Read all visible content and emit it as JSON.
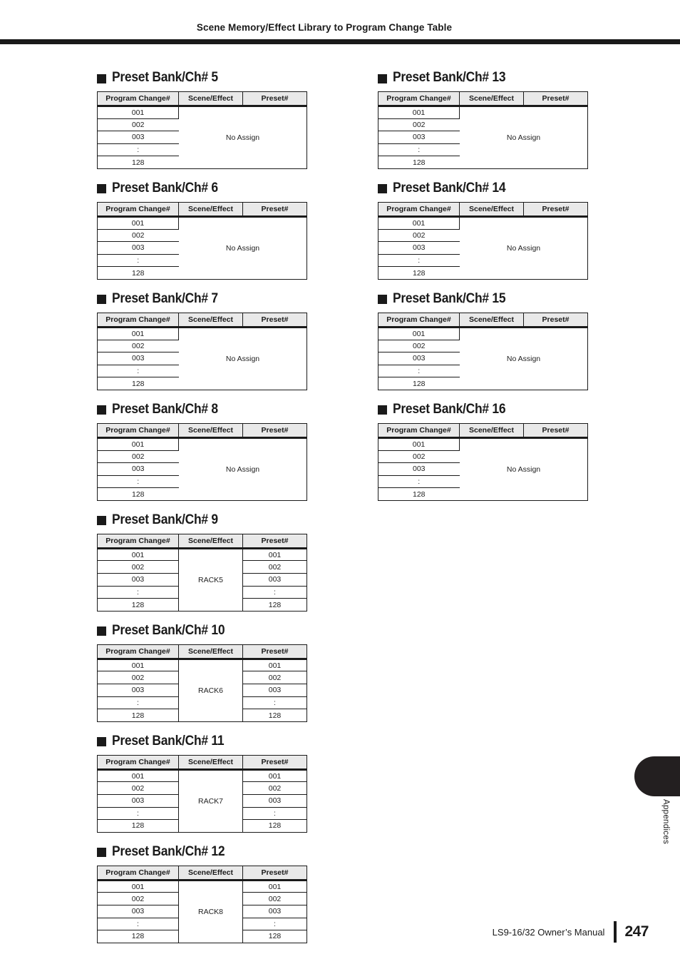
{
  "header": {
    "title": "Scene Memory/Effect Library to Program Change Table"
  },
  "table_headers": {
    "program_change": "Program Change#",
    "scene_effect": "Scene/Effect",
    "preset": "Preset#"
  },
  "program_change_rows": [
    "001",
    "002",
    "003",
    ":",
    "128"
  ],
  "no_assign_label": "No Assign",
  "sections": {
    "left": [
      {
        "title": "Preset Bank/Ch# 5",
        "assigned": false,
        "scene_effect": "No Assign",
        "program_change": [
          "001",
          "002",
          "003",
          ":",
          "128"
        ],
        "preset": []
      },
      {
        "title": "Preset Bank/Ch# 6",
        "assigned": false,
        "scene_effect": "No Assign",
        "program_change": [
          "001",
          "002",
          "003",
          ":",
          "128"
        ],
        "preset": []
      },
      {
        "title": "Preset Bank/Ch# 7",
        "assigned": false,
        "scene_effect": "No Assign",
        "program_change": [
          "001",
          "002",
          "003",
          ":",
          "128"
        ],
        "preset": []
      },
      {
        "title": "Preset Bank/Ch# 8",
        "assigned": false,
        "scene_effect": "No Assign",
        "program_change": [
          "001",
          "002",
          "003",
          ":",
          "128"
        ],
        "preset": []
      },
      {
        "title": "Preset Bank/Ch# 9",
        "assigned": true,
        "scene_effect": "RACK5",
        "program_change": [
          "001",
          "002",
          "003",
          ":",
          "128"
        ],
        "preset": [
          "001",
          "002",
          "003",
          ":",
          "128"
        ]
      },
      {
        "title": "Preset Bank/Ch# 10",
        "assigned": true,
        "scene_effect": "RACK6",
        "program_change": [
          "001",
          "002",
          "003",
          ":",
          "128"
        ],
        "preset": [
          "001",
          "002",
          "003",
          ":",
          "128"
        ]
      },
      {
        "title": "Preset Bank/Ch# 11",
        "assigned": true,
        "scene_effect": "RACK7",
        "program_change": [
          "001",
          "002",
          "003",
          ":",
          "128"
        ],
        "preset": [
          "001",
          "002",
          "003",
          ":",
          "128"
        ]
      },
      {
        "title": "Preset Bank/Ch# 12",
        "assigned": true,
        "scene_effect": "RACK8",
        "program_change": [
          "001",
          "002",
          "003",
          ":",
          "128"
        ],
        "preset": [
          "001",
          "002",
          "003",
          ":",
          "128"
        ]
      }
    ],
    "right": [
      {
        "title": "Preset Bank/Ch# 13",
        "assigned": false,
        "scene_effect": "No Assign",
        "program_change": [
          "001",
          "002",
          "003",
          ":",
          "128"
        ],
        "preset": []
      },
      {
        "title": "Preset Bank/Ch# 14",
        "assigned": false,
        "scene_effect": "No Assign",
        "program_change": [
          "001",
          "002",
          "003",
          ":",
          "128"
        ],
        "preset": []
      },
      {
        "title": "Preset Bank/Ch# 15",
        "assigned": false,
        "scene_effect": "No Assign",
        "program_change": [
          "001",
          "002",
          "003",
          ":",
          "128"
        ],
        "preset": []
      },
      {
        "title": "Preset Bank/Ch# 16",
        "assigned": false,
        "scene_effect": "No Assign",
        "program_change": [
          "001",
          "002",
          "003",
          ":",
          "128"
        ],
        "preset": []
      }
    ]
  },
  "side_tab": {
    "label": "Appendices"
  },
  "footer": {
    "manual": "LS9-16/32  Owner’s Manual",
    "page_number": "247"
  },
  "colors": {
    "ink": "#1a1a1a",
    "header_fill": "#e9e9e9",
    "tab_black": "#231f20"
  }
}
